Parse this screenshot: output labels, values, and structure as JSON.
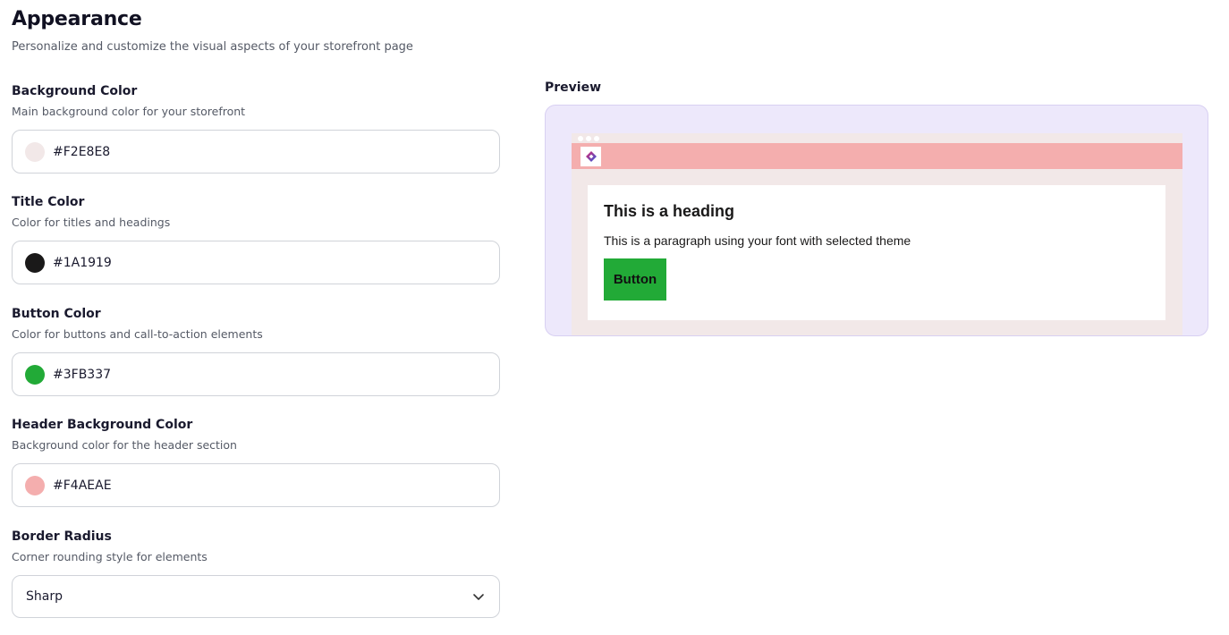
{
  "header": {
    "title": "Appearance",
    "subtitle": "Personalize and customize the visual aspects of your storefront page"
  },
  "fields": [
    {
      "label": "Background Color",
      "description": "Main background color for your storefront",
      "value": "#F2E8E8",
      "swatch_color": "#F2E8E8"
    },
    {
      "label": "Title Color",
      "description": "Color for titles and headings",
      "value": "#1A1919",
      "swatch_color": "#1A1919"
    },
    {
      "label": "Button Color",
      "description": "Color for buttons and call-to-action elements",
      "value": "#3FB337",
      "swatch_color": "#22AA37"
    },
    {
      "label": "Header Background Color",
      "description": "Background color for the header section",
      "value": "#F4AEAE",
      "swatch_color": "#F4AEAE"
    }
  ],
  "border_radius": {
    "label": "Border Radius",
    "description": "Corner rounding style for elements",
    "selected": "Sharp",
    "icon": "chevron-down-icon"
  },
  "preview": {
    "label": "Preview",
    "heading": "This is a heading",
    "paragraph": "This is a paragraph using your font with selected theme",
    "button_label": "Button",
    "logo_icon": "store-logo-icon",
    "colors": {
      "frame_bg": "#EDE8FB",
      "page_bg": "#F2E8E8",
      "header_bg": "#F4AEAE",
      "button_bg": "#22AA37",
      "text": "#1A1919"
    }
  }
}
